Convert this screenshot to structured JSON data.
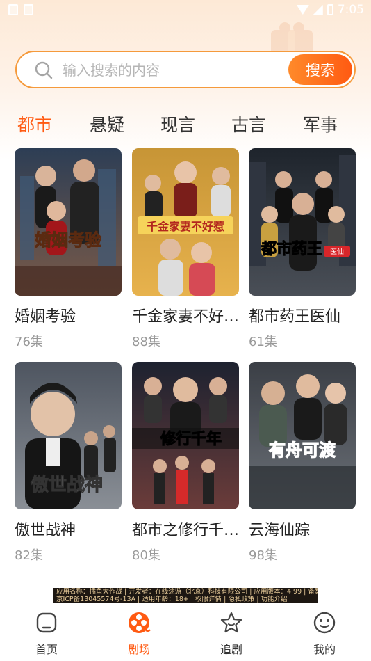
{
  "status_bar": {
    "time": "7:05"
  },
  "search": {
    "placeholder": "输入搜索的内容",
    "button_label": "搜索"
  },
  "category_tabs": [
    {
      "label": "都市",
      "active": true
    },
    {
      "label": "悬疑",
      "active": false
    },
    {
      "label": "现言",
      "active": false
    },
    {
      "label": "古言",
      "active": false
    },
    {
      "label": "军事",
      "active": false
    }
  ],
  "dramas": [
    {
      "title": "婚姻考验",
      "episodes": "76集",
      "poster_text": "婚姻考验",
      "poster_colors": [
        "#2d3e55",
        "#7a5a48"
      ]
    },
    {
      "title": "千金家妻不好…",
      "episodes": "88集",
      "poster_text": "千金家妻不好惹",
      "poster_colors": [
        "#c79536",
        "#e7b24d"
      ]
    },
    {
      "title": "都市药王医仙",
      "episodes": "61集",
      "poster_text": "都市药王",
      "poster_badge": "医仙",
      "poster_colors": [
        "#1e242c",
        "#4a4f57"
      ]
    },
    {
      "title": "傲世战神",
      "episodes": "82集",
      "poster_text": "傲世战神",
      "poster_colors": [
        "#4e5560",
        "#8a8f96"
      ]
    },
    {
      "title": "都市之修行千…",
      "episodes": "80集",
      "poster_text": "修行千年",
      "poster_colors": [
        "#1d2230",
        "#6b3c3a"
      ]
    },
    {
      "title": "云海仙踪",
      "episodes": "98集",
      "poster_text": "有舟可渡",
      "poster_colors": [
        "#3b3f46",
        "#6b7077"
      ]
    }
  ],
  "banner": {
    "line1": "应用名称：插鱼大作战 | 开发者：在线途游（北京）科技有限公司 | 应用版本：4.99 | 备案号：",
    "line2": "京ICP备13045574号-13A | 适用年龄：18+ | 权限详情 | 隐私政策 | 功能介绍"
  },
  "bottom_nav": [
    {
      "label": "首页",
      "icon": "home-icon",
      "active": false
    },
    {
      "label": "剧场",
      "icon": "film-reel-icon",
      "active": true
    },
    {
      "label": "追剧",
      "icon": "star-icon",
      "active": false
    },
    {
      "label": "我的",
      "icon": "smile-face-icon",
      "active": false
    }
  ],
  "colors": {
    "accent": "#ff5a12",
    "search_border": "#f59a3c",
    "muted_text": "#999999"
  }
}
